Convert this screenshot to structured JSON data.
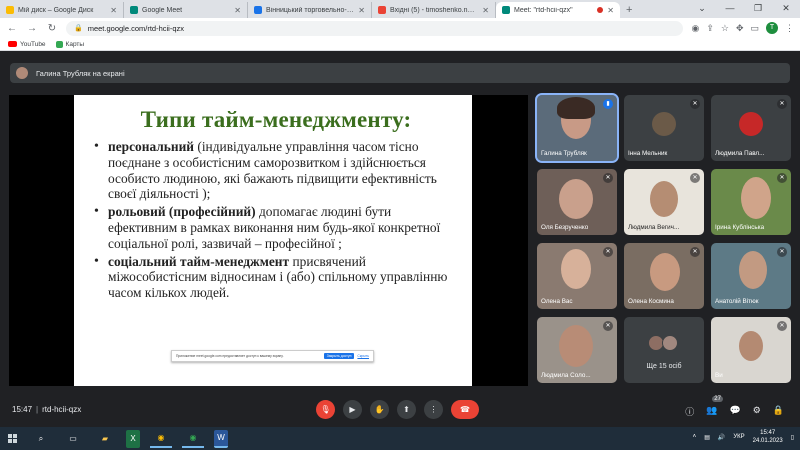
{
  "browser": {
    "tabs": [
      {
        "title": "Мій диск – Google Диск",
        "fav_color": "#fbbc04"
      },
      {
        "title": "Google Meet",
        "fav_color": "#00897b"
      },
      {
        "title": "Вінницький торговельно-економ",
        "fav_color": "#1a73e8"
      },
      {
        "title": "Вхідні (5) - timoshenko.natalia",
        "fav_color": "#ea4335"
      },
      {
        "title": "Meet: \"rtd-hcii-qzx\"",
        "fav_color": "#00897b",
        "active": true
      }
    ],
    "url": "meet.google.com/rtd-hcii-qzx",
    "profile_initial": "T",
    "bookmarks": [
      "YouTube",
      "Карты"
    ]
  },
  "meet": {
    "presenter_text": "Галина Трубляк на екрані",
    "slide": {
      "title": "Типи тайм-менеджменту:",
      "bullets": [
        {
          "bold": "персональний",
          "rest": " (індивідуальне управління часом тісно поєднане з особистісним саморозвитком і здійснюється особисто людиною, які бажають підвищити ефективність своєї діяльності );"
        },
        {
          "bold": "рольовий (професійний)",
          "rest": " допомагає людині бути ефективним в рамках виконання ним будь-якої конкретної соціальної ролі, зазвичай – професійної ;"
        },
        {
          "bold": "соціальний тайм-менеджмент",
          "rest": " присвячений міжособистісним відносинам і (або) спільному управлінню часом кількох людей."
        }
      ],
      "share_notice": "Приложение meet.google.com предоставляет доступ к вашему экрану.",
      "share_stop": "Закрыть доступ",
      "share_hide": "Скрыть"
    },
    "participants": [
      {
        "name": "Галина Трубляк",
        "speaking": true
      },
      {
        "name": "Інна Мельник"
      },
      {
        "name": "Людмила Павл..."
      },
      {
        "name": "Оля Безрученко"
      },
      {
        "name": "Людмила Вегич..."
      },
      {
        "name": "Ірина Кублінська"
      },
      {
        "name": "Олена Вас"
      },
      {
        "name": "Олена Космина"
      },
      {
        "name": "Анатолій Вітюк"
      },
      {
        "name": "Людмила Соло..."
      },
      {
        "name": "Ви"
      }
    ],
    "more_label": "Ще 15 осіб",
    "time": "15:47",
    "meeting_code": "rtd-hcii-qzx",
    "people_count": "27"
  },
  "taskbar": {
    "lang": "УКР",
    "time": "15:47",
    "date": "24.01.2023"
  }
}
